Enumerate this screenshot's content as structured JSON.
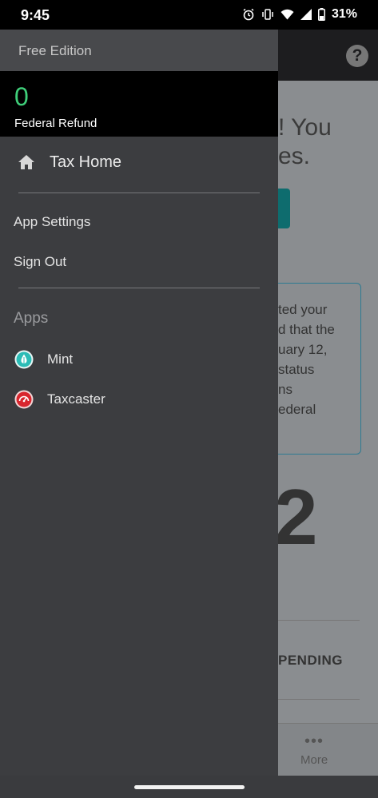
{
  "status_bar": {
    "time": "9:45",
    "battery": "31%",
    "icons": [
      "alarm-icon",
      "vibrate-icon",
      "wifi-icon",
      "signal-icon",
      "battery-icon"
    ]
  },
  "background_app": {
    "hero_lines": [
      "! You",
      "es."
    ],
    "card_lines": [
      "ted your",
      "d that the",
      "uary 12,",
      " status",
      "ns",
      "ederal"
    ],
    "big_number": "2",
    "pending_label": "PENDING",
    "more_label": "More",
    "more_dots": "•••"
  },
  "drawer": {
    "edition": "Free Edition",
    "refund": {
      "amount": "0",
      "label": "Federal Refund",
      "amount_color": "#3fcf7a"
    },
    "tax_home": "Tax Home",
    "menu": [
      "App Settings",
      "Sign Out"
    ],
    "apps_header": "Apps",
    "apps": [
      {
        "label": "Mint",
        "icon": "mint-icon",
        "color": "#2bbcb6"
      },
      {
        "label": "Taxcaster",
        "icon": "taxcaster-icon",
        "color": "#d8262e"
      }
    ]
  }
}
